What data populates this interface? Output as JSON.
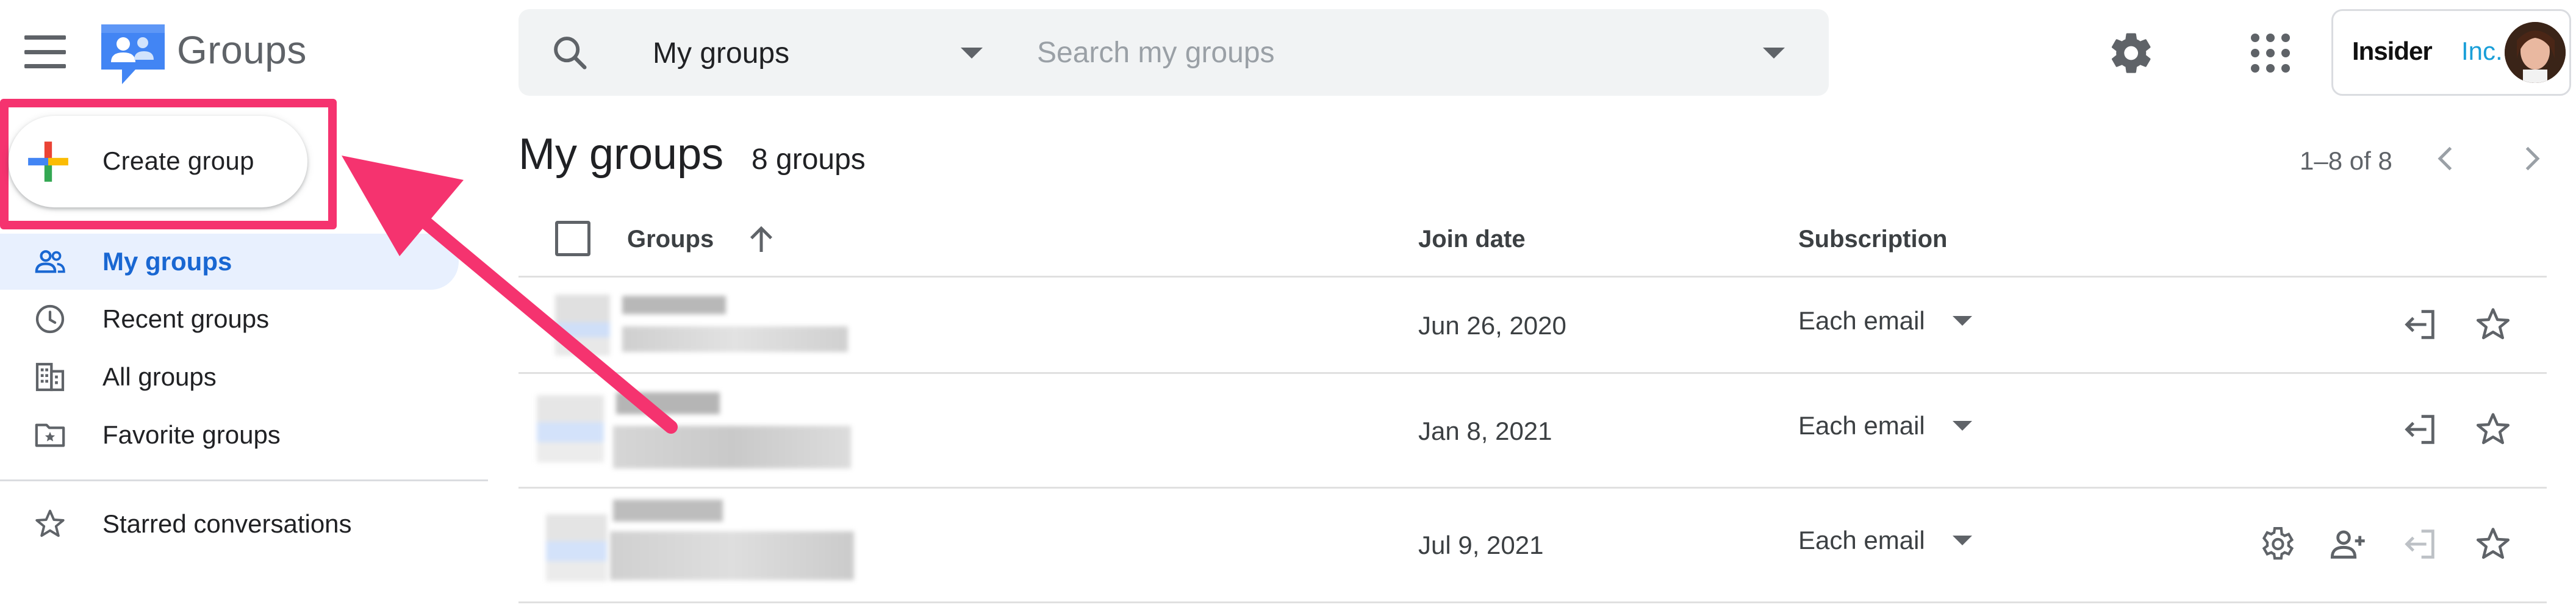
{
  "header": {
    "app_name": "Groups",
    "scope_select": {
      "selected": "My groups"
    },
    "search": {
      "placeholder": "Search my groups"
    },
    "account": {
      "brand_name": "Insider",
      "brand_suffix": "Inc."
    }
  },
  "create_button": {
    "label": "Create group"
  },
  "sidebar": {
    "items": [
      {
        "label": "My groups",
        "icon": "people-icon",
        "active": true
      },
      {
        "label": "Recent groups",
        "icon": "clock-icon",
        "active": false
      },
      {
        "label": "All groups",
        "icon": "building-icon",
        "active": false
      },
      {
        "label": "Favorite groups",
        "icon": "starred-folder-icon",
        "active": false
      },
      {
        "label": "Starred conversations",
        "icon": "star-icon",
        "active": false
      }
    ]
  },
  "main": {
    "title": "My groups",
    "count": "8 groups",
    "pagination": "1–8 of 8",
    "columns": {
      "groups": "Groups",
      "join_date": "Join date",
      "subscription": "Subscription"
    },
    "rows": [
      {
        "join_date": "Jun 26, 2020",
        "subscription": "Each email",
        "actions": [
          "leave-group-icon",
          "star-icon"
        ]
      },
      {
        "join_date": "Jan 8, 2021",
        "subscription": "Each email",
        "actions": [
          "leave-group-icon",
          "star-icon"
        ]
      },
      {
        "join_date": "Jul 9, 2021",
        "subscription": "Each email",
        "actions": [
          "settings-icon",
          "add-member-icon",
          "leave-group-icon",
          "star-icon"
        ]
      }
    ]
  },
  "colors": {
    "highlight": "#f5336f",
    "active_nav_bg": "#e8f0fe",
    "active_nav_text": "#1967d2",
    "searchbar_bg": "#f1f3f4",
    "brand_inc": "#1a9fd8"
  }
}
